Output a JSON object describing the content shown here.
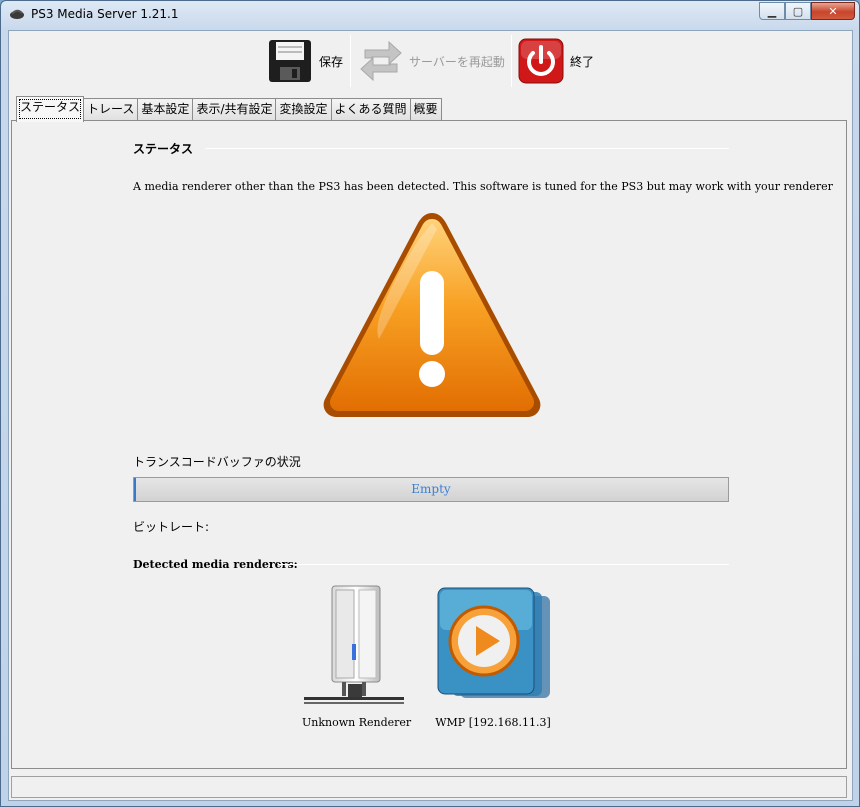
{
  "window": {
    "title": "PS3 Media Server 1.21.1"
  },
  "toolbar": {
    "save_label": "保存",
    "restart_label": "サーバーを再起動",
    "quit_label": "終了"
  },
  "tabs": [
    {
      "label": "ステータス"
    },
    {
      "label": "トレース"
    },
    {
      "label": "基本設定"
    },
    {
      "label": "表示/共有設定"
    },
    {
      "label": "変換設定"
    },
    {
      "label": "よくある質問"
    },
    {
      "label": "概要"
    }
  ],
  "status": {
    "section_title": "ステータス",
    "message": "A media renderer other than the PS3 has been detected. This software is tuned for the PS3 but may work with your renderer",
    "buffer_label": "トランスコードバッファの状況",
    "buffer_text": "Empty",
    "buffer_fill": 0,
    "bitrate_label": "ビットレート:",
    "renderers_title": "Detected media renderers:",
    "renderers": [
      {
        "name": "Unknown Renderer"
      },
      {
        "name": "WMP [192.168.11.3]"
      }
    ]
  },
  "colors": {
    "accent": "#3d7fd1",
    "warning": "#f08a0c",
    "quit": "#d01818"
  }
}
